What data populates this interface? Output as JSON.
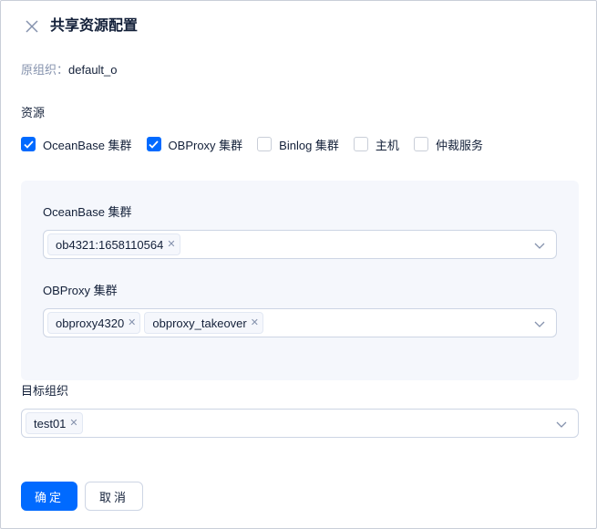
{
  "drawer": {
    "title": "共享资源配置",
    "close_icon": "close-icon"
  },
  "original_org": {
    "label": "原组织：",
    "value": "default_o"
  },
  "resources": {
    "label": "资源",
    "options": [
      {
        "label": "OceanBase 集群",
        "checked": true
      },
      {
        "label": "OBProxy 集群",
        "checked": true
      },
      {
        "label": "Binlog 集群",
        "checked": false
      },
      {
        "label": "主机",
        "checked": false
      },
      {
        "label": "仲裁服务",
        "checked": false
      }
    ]
  },
  "oceanbase_select": {
    "label": "OceanBase 集群",
    "tags": [
      "ob4321:1658110564"
    ]
  },
  "obproxy_select": {
    "label": "OBProxy 集群",
    "tags": [
      "obproxy4320",
      "obproxy_takeover"
    ]
  },
  "target_org": {
    "label": "目标组织",
    "tags": [
      "test01"
    ]
  },
  "footer": {
    "confirm_label": "确定",
    "cancel_label": "取消"
  },
  "colors": {
    "primary": "#006aff",
    "text": "#132039",
    "muted": "#8592ad",
    "panel_bg": "#f5f7fc"
  }
}
